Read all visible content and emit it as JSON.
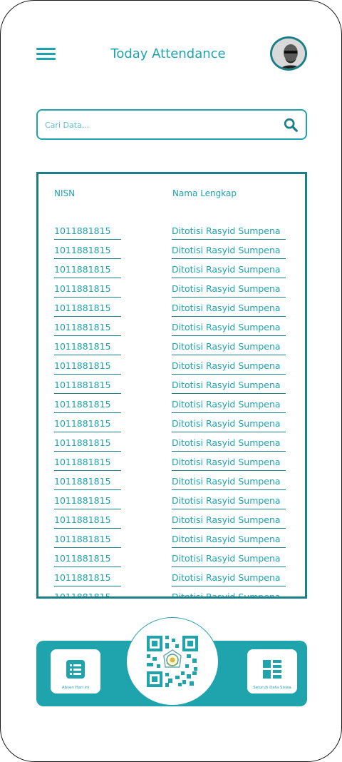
{
  "header": {
    "title": "Today Attendance"
  },
  "search": {
    "placeholder": "Cari Data..."
  },
  "table": {
    "columns": [
      "NISN",
      "Nama Lengkap"
    ],
    "rows": [
      {
        "nisn": "1011881815",
        "name": "Ditotisi Rasyid Sumpena"
      },
      {
        "nisn": "1011881815",
        "name": "Ditotisi Rasyid Sumpena"
      },
      {
        "nisn": "1011881815",
        "name": "Ditotisi Rasyid Sumpena"
      },
      {
        "nisn": "1011881815",
        "name": "Ditotisi Rasyid Sumpena"
      },
      {
        "nisn": "1011881815",
        "name": "Ditotisi Rasyid Sumpena"
      },
      {
        "nisn": "1011881815",
        "name": "Ditotisi Rasyid Sumpena"
      },
      {
        "nisn": "1011881815",
        "name": "Ditotisi Rasyid Sumpena"
      },
      {
        "nisn": "1011881815",
        "name": "Ditotisi Rasyid Sumpena"
      },
      {
        "nisn": "1011881815",
        "name": "Ditotisi Rasyid Sumpena"
      },
      {
        "nisn": "1011881815",
        "name": "Ditotisi Rasyid Sumpena"
      },
      {
        "nisn": "1011881815",
        "name": "Ditotisi Rasyid Sumpena"
      },
      {
        "nisn": "1011881815",
        "name": "Ditotisi Rasyid Sumpena"
      },
      {
        "nisn": "1011881815",
        "name": "Ditotisi Rasyid Sumpena"
      },
      {
        "nisn": "1011881815",
        "name": "Ditotisi Rasyid Sumpena"
      },
      {
        "nisn": "1011881815",
        "name": "Ditotisi Rasyid Sumpena"
      },
      {
        "nisn": "1011881815",
        "name": "Ditotisi Rasyid Sumpena"
      },
      {
        "nisn": "1011881815",
        "name": "Ditotisi Rasyid Sumpena"
      },
      {
        "nisn": "1011881815",
        "name": "Ditotisi Rasyid Sumpena"
      },
      {
        "nisn": "1011881815",
        "name": "Ditotisi Rasyid Sumpena"
      },
      {
        "nisn": "1011881815",
        "name": "Ditotisi Rasyid Sumpena"
      }
    ]
  },
  "nav": {
    "left_label": "Absen Hari ini",
    "right_label": "Seluruh Data Siswa",
    "left_icon": "list-icon",
    "center_icon": "qr-code-icon",
    "right_icon": "grid-list-icon"
  },
  "colors": {
    "accent": "#1fa3ad",
    "dark_accent": "#1b7f88"
  }
}
